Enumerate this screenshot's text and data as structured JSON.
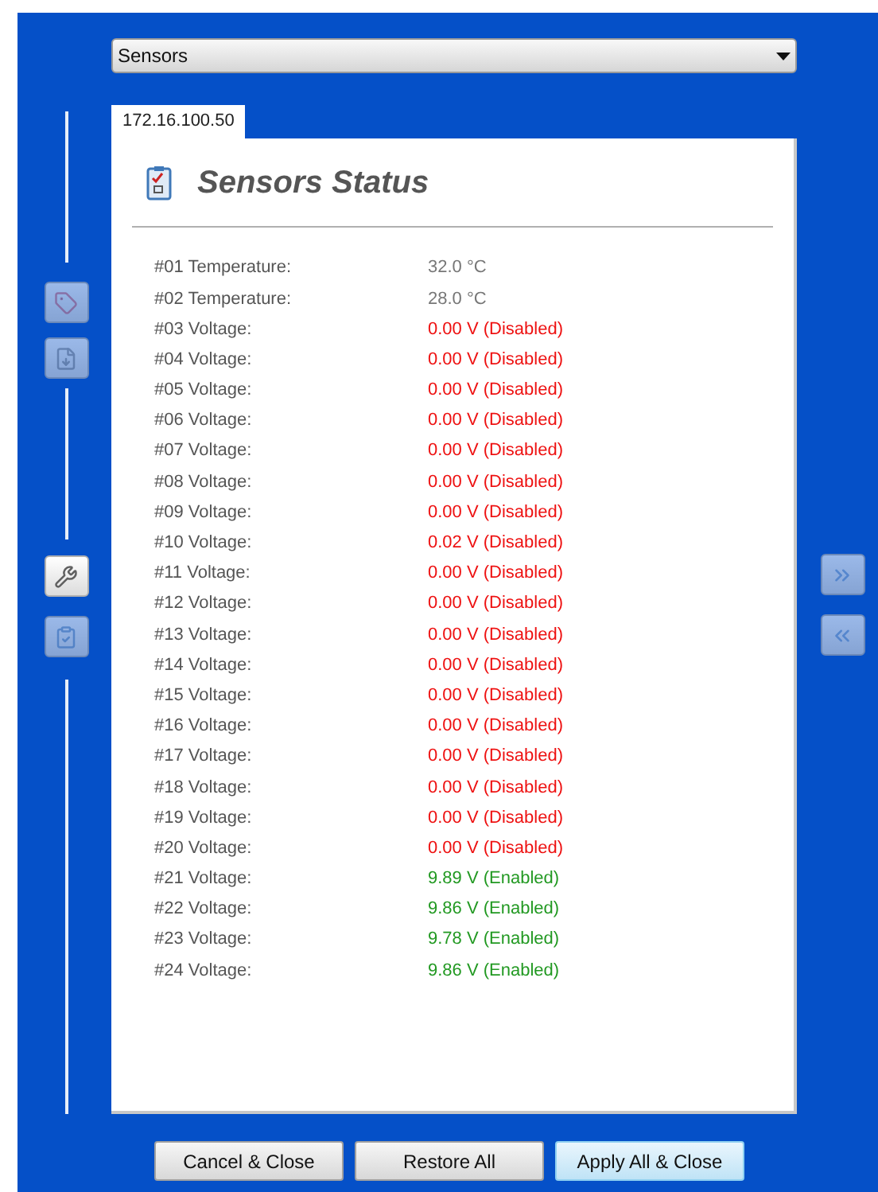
{
  "dropdown": {
    "value": "Sensors"
  },
  "tabs": [
    {
      "label": "172.16.100.50",
      "selected": true
    }
  ],
  "panel": {
    "title": "Sensors Status"
  },
  "left_tools": [
    {
      "kind": "tag",
      "disabled": true
    },
    {
      "kind": "save",
      "disabled": true
    },
    {
      "kind": "wrench",
      "disabled": false
    },
    {
      "kind": "clipboard",
      "disabled": true
    }
  ],
  "right_tools": [
    {
      "kind": "forward",
      "disabled": true
    },
    {
      "kind": "back",
      "disabled": true
    }
  ],
  "sensors": [
    {
      "label": "#01 Temperature:",
      "value": "32.0 °C",
      "kind": "reading"
    },
    {
      "label": "#02 Temperature:",
      "value": "28.0 °C",
      "kind": "reading"
    },
    {
      "label": "#03 Voltage:",
      "value": "0.00 V (Disabled)",
      "kind": "disabled"
    },
    {
      "label": "#04 Voltage:",
      "value": "0.00 V (Disabled)",
      "kind": "disabled"
    },
    {
      "label": "#05 Voltage:",
      "value": "0.00 V (Disabled)",
      "kind": "disabled"
    },
    {
      "label": "#06 Voltage:",
      "value": "0.00 V (Disabled)",
      "kind": "disabled"
    },
    {
      "label": "#07 Voltage:",
      "value": "0.00 V (Disabled)",
      "kind": "disabled"
    },
    {
      "label": "#08 Voltage:",
      "value": "0.00 V (Disabled)",
      "kind": "disabled"
    },
    {
      "label": "#09 Voltage:",
      "value": "0.00 V (Disabled)",
      "kind": "disabled"
    },
    {
      "label": "#10 Voltage:",
      "value": "0.02 V (Disabled)",
      "kind": "disabled"
    },
    {
      "label": "#11 Voltage:",
      "value": "0.00 V (Disabled)",
      "kind": "disabled"
    },
    {
      "label": "#12 Voltage:",
      "value": "0.00 V (Disabled)",
      "kind": "disabled"
    },
    {
      "label": "#13 Voltage:",
      "value": "0.00 V (Disabled)",
      "kind": "disabled"
    },
    {
      "label": "#14 Voltage:",
      "value": "0.00 V (Disabled)",
      "kind": "disabled"
    },
    {
      "label": "#15 Voltage:",
      "value": "0.00 V (Disabled)",
      "kind": "disabled"
    },
    {
      "label": "#16 Voltage:",
      "value": "0.00 V (Disabled)",
      "kind": "disabled"
    },
    {
      "label": "#17 Voltage:",
      "value": "0.00 V (Disabled)",
      "kind": "disabled"
    },
    {
      "label": "#18 Voltage:",
      "value": "0.00 V (Disabled)",
      "kind": "disabled"
    },
    {
      "label": "#19 Voltage:",
      "value": "0.00 V (Disabled)",
      "kind": "disabled"
    },
    {
      "label": "#20 Voltage:",
      "value": "0.00 V (Disabled)",
      "kind": "disabled"
    },
    {
      "label": "#21 Voltage:",
      "value": "9.89 V (Enabled)",
      "kind": "enabled"
    },
    {
      "label": "#22 Voltage:",
      "value": "9.86 V (Enabled)",
      "kind": "enabled"
    },
    {
      "label": "#23 Voltage:",
      "value": "9.78 V (Enabled)",
      "kind": "enabled"
    },
    {
      "label": "#24 Voltage:",
      "value": "9.86 V (Enabled)",
      "kind": "enabled"
    }
  ],
  "buttons": [
    {
      "label": "Cancel & Close",
      "focused": false
    },
    {
      "label": "Restore All",
      "focused": false
    },
    {
      "label": "Apply All & Close",
      "focused": true
    }
  ]
}
